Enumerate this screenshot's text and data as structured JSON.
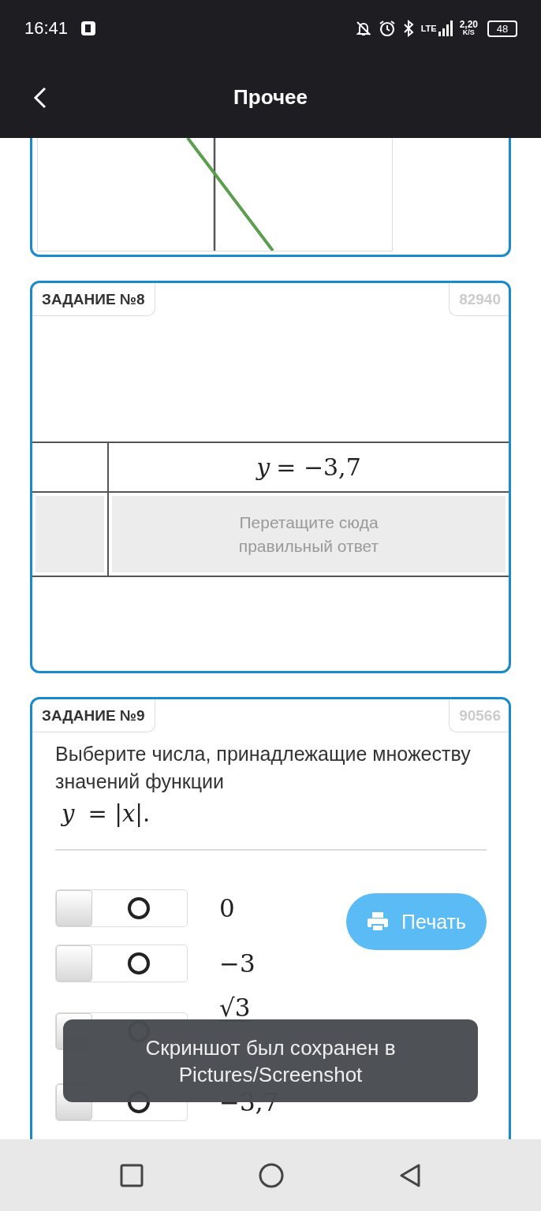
{
  "status_bar": {
    "time": "16:41",
    "network": "LTE",
    "speed": "2,20",
    "speed_unit": "K/S",
    "battery": "48"
  },
  "header": {
    "title": "Прочее"
  },
  "tasks": [
    {
      "kind": "graph"
    },
    {
      "kind": "table",
      "title": "ЗАДАНИЕ №8",
      "number": "82940",
      "formula": "*y* = −3,7",
      "drop_hint": "Перетащите сюда правильный ответ"
    },
    {
      "kind": "choice",
      "title": "ЗАДАНИЕ №9",
      "number": "90566",
      "question": "Выберите числа, принадлежащие множеству значений функции",
      "formula": "*y* = |*x*|.",
      "options": [
        {
          "kind": "number",
          "value": "0",
          "selected": false
        },
        {
          "kind": "number",
          "value": "−3",
          "selected": false
        },
        {
          "kind": "fraction",
          "numerator": "√3",
          "selected": false
        },
        {
          "kind": "number",
          "value": "−3,7",
          "selected": false
        }
      ],
      "print_button": "Печать"
    }
  ],
  "toast": "Скриншот был сохранен в Pictures/Screenshot"
}
